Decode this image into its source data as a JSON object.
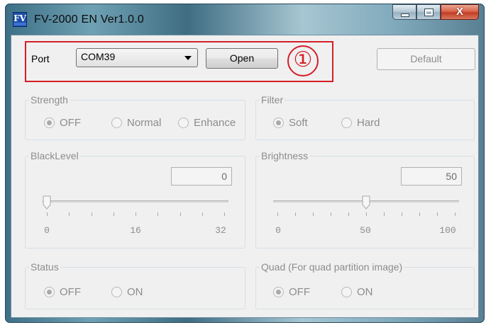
{
  "window": {
    "title": "FV-2000 EN Ver1.0.0",
    "icon_text": "FV",
    "controls": [
      "minimize-icon",
      "maximize-icon",
      "close-icon"
    ],
    "close_glyph": "X"
  },
  "port": {
    "label": "Port",
    "selected": "COM39",
    "open_label": "Open",
    "default_label": "Default",
    "callout": "①",
    "highlight_color": "#d51e26"
  },
  "strength": {
    "title": "Strength",
    "options": [
      {
        "label": "OFF",
        "checked": true
      },
      {
        "label": "Normal",
        "checked": false
      },
      {
        "label": "Enhance",
        "checked": false
      }
    ]
  },
  "filter": {
    "title": "Filter",
    "options": [
      {
        "label": "Soft",
        "checked": true
      },
      {
        "label": "Hard",
        "checked": false
      }
    ]
  },
  "black_level": {
    "title": "BlackLevel",
    "value": "0",
    "min": 0,
    "max": 32,
    "current": 0,
    "ticks": [
      "0",
      "16",
      "32"
    ]
  },
  "brightness": {
    "title": "Brightness",
    "value": "50",
    "min": 0,
    "max": 100,
    "current": 50,
    "ticks": [
      "0",
      "50",
      "100"
    ]
  },
  "status": {
    "title": "Status",
    "options": [
      {
        "label": "OFF",
        "checked": true
      },
      {
        "label": "ON",
        "checked": false
      }
    ]
  },
  "quad": {
    "title": "Quad (For quad partition image)",
    "options": [
      {
        "label": "OFF",
        "checked": true
      },
      {
        "label": "ON",
        "checked": false
      }
    ]
  }
}
